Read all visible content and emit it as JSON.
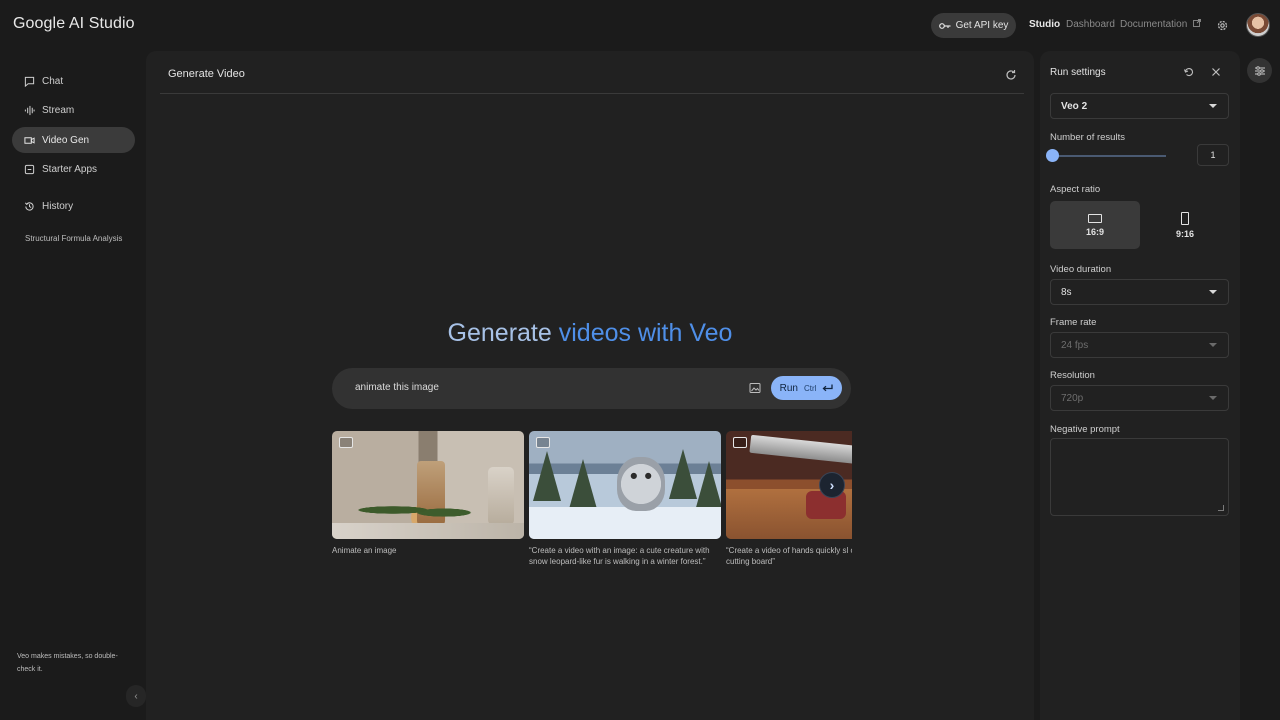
{
  "header": {
    "app_title": "Google AI Studio",
    "api_key_label": "Get API key",
    "links": {
      "studio": "Studio",
      "dashboard": "Dashboard",
      "documentation": "Documentation"
    }
  },
  "sidebar": {
    "items": [
      {
        "label": "Chat",
        "icon": "chat-icon"
      },
      {
        "label": "Stream",
        "icon": "stream-icon"
      },
      {
        "label": "Video Gen",
        "icon": "video-icon"
      },
      {
        "label": "Starter Apps",
        "icon": "apps-icon"
      },
      {
        "label": "History",
        "icon": "history-icon"
      }
    ],
    "history_entry": "Structural Formula Analysis",
    "disclaimer": "Veo makes mistakes, so double-check it."
  },
  "main": {
    "title": "Generate Video",
    "headline_part1": "Generate",
    "headline_part2": "videos with Veo",
    "prompt_value": "animate this image",
    "run_label": "Run",
    "run_shortcut": "Ctrl",
    "examples": [
      {
        "caption": "Animate an image"
      },
      {
        "caption": "“Create a video with an image: a cute creature with snow leopard-like fur is walking in a winter forest.”"
      },
      {
        "caption": "“Create a video of hands quickly sl on a wooden cutting board”"
      }
    ]
  },
  "settings": {
    "title": "Run settings",
    "model": "Veo 2",
    "number_of_results_label": "Number of results",
    "number_of_results_value": "1",
    "aspect_ratio_label": "Aspect ratio",
    "aspect_options": [
      "16:9",
      "9:16"
    ],
    "aspect_selected": "16:9",
    "video_duration_label": "Video duration",
    "video_duration_value": "8s",
    "frame_rate_label": "Frame rate",
    "frame_rate_value": "24 fps",
    "resolution_label": "Resolution",
    "resolution_value": "720p",
    "negative_prompt_label": "Negative prompt"
  }
}
